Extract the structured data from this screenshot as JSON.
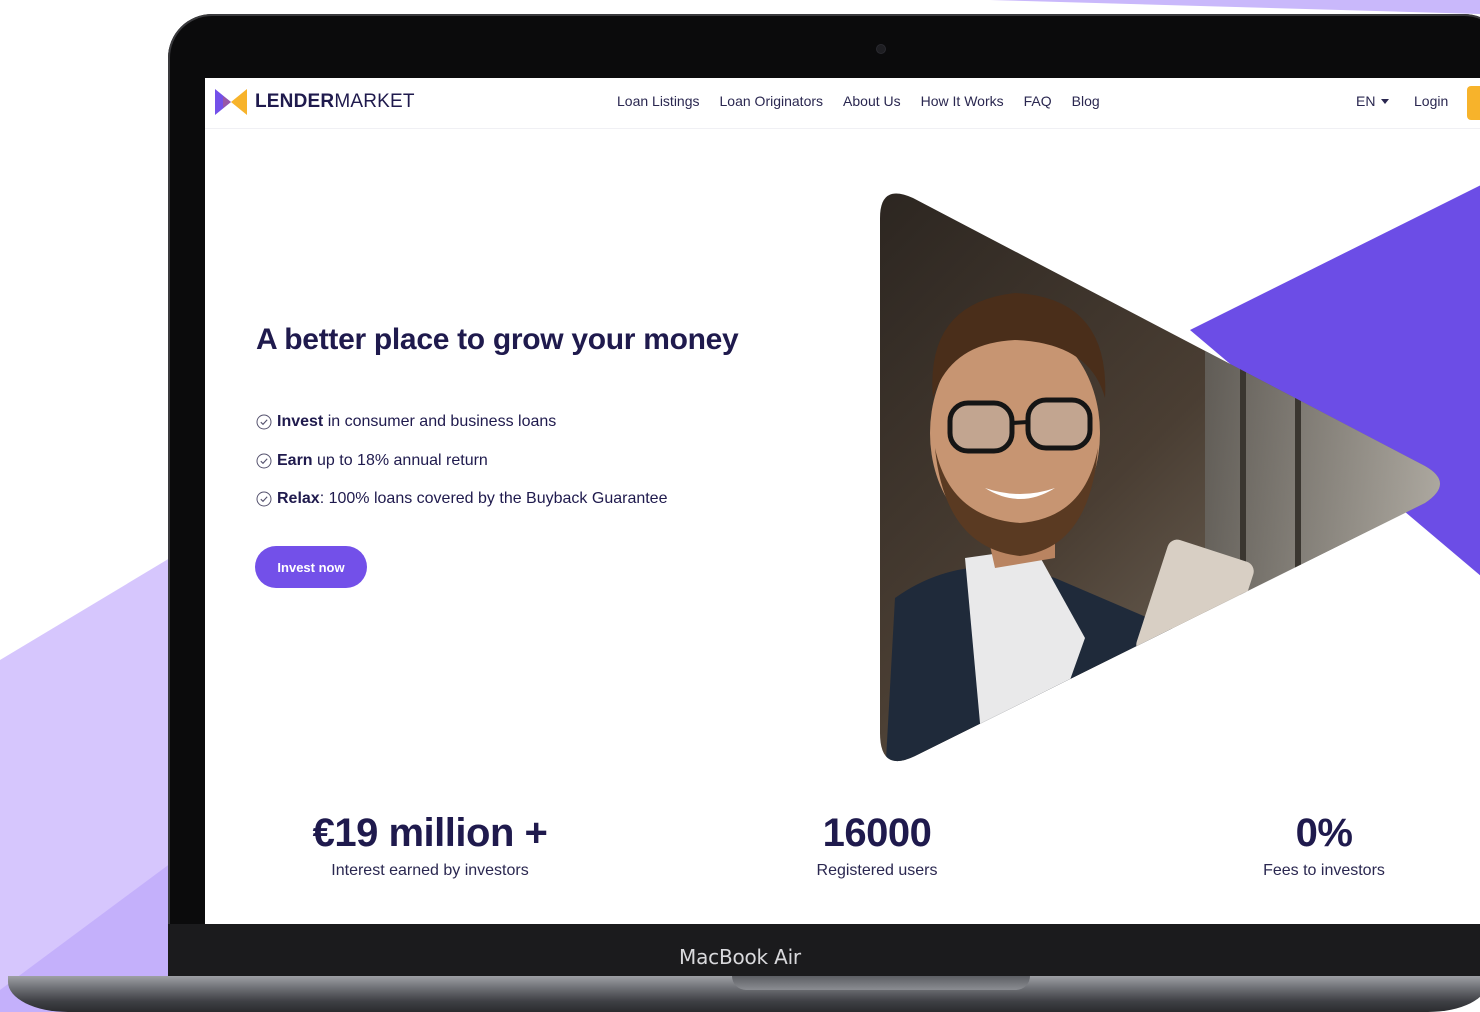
{
  "brand": {
    "name_bold": "LENDER",
    "name_light": "MARKET",
    "primary_color": "#7350e9",
    "accent_color": "#f7b32b",
    "text_color": "#1f1a4d"
  },
  "nav": {
    "links": [
      "Loan Listings",
      "Loan Originators",
      "About Us",
      "How It Works",
      "FAQ",
      "Blog"
    ],
    "language": "EN",
    "login": "Login"
  },
  "hero": {
    "title": "A better place to grow your money",
    "bullets": [
      {
        "bold": "Invest",
        "text": " in consumer and business loans"
      },
      {
        "bold": "Earn",
        "text": " up to 18% annual return"
      },
      {
        "bold": "Relax",
        "text": ": 100% loans covered by the Buyback Guarantee"
      }
    ],
    "cta": "Invest now",
    "image_icon": "smiling-man-with-phone-photo"
  },
  "stats": [
    {
      "value": "€19 million +",
      "label": "Interest earned by investors"
    },
    {
      "value": "16000",
      "label": "Registered users"
    },
    {
      "value": "0%",
      "label": "Fees to investors"
    }
  ],
  "device": {
    "label": "MacBook Air"
  }
}
